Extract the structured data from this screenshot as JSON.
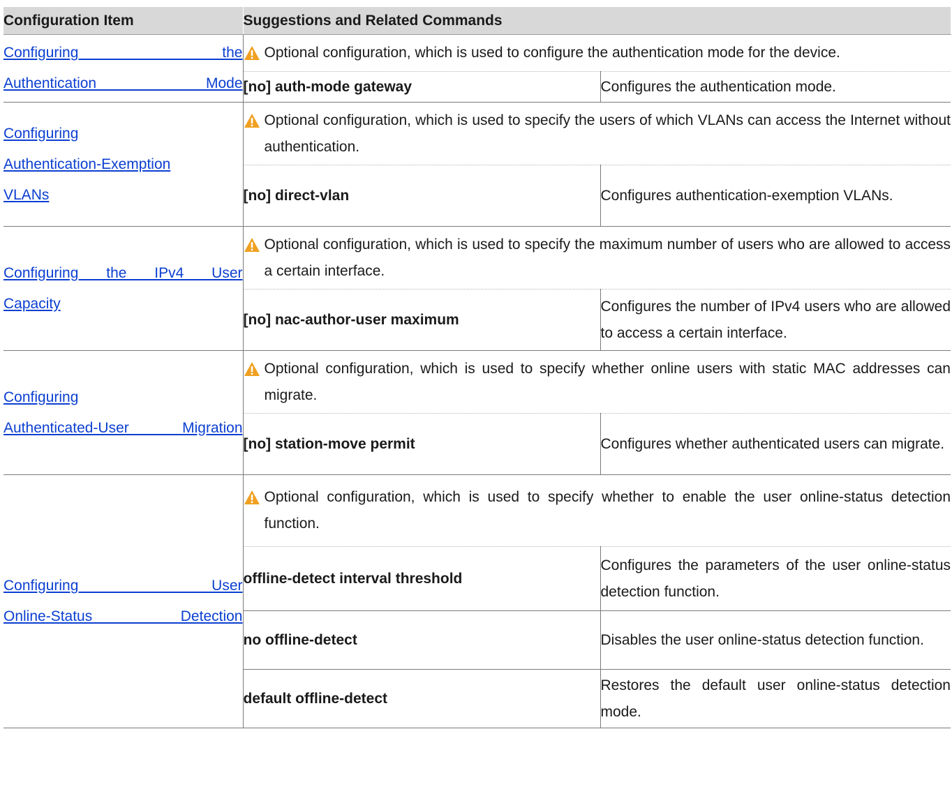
{
  "headers": {
    "config_item": "Configuration Item",
    "suggestions": "Suggestions and Related Commands"
  },
  "rows": [
    {
      "item_lines": [
        "Configuring the",
        "Authentication Mode"
      ],
      "suggestion": "Optional configuration, which is used to configure the authentication mode for the device.",
      "commands": [
        {
          "cmd": "[no] auth-mode gateway",
          "desc": "Configures the authentication mode."
        }
      ]
    },
    {
      "item_lines": [
        "Configuring",
        "Authentication-Exemption",
        "VLANs"
      ],
      "suggestion": "Optional configuration, which is used to specify the users of which VLANs can access the Internet without authentication.",
      "commands": [
        {
          "cmd": "[no] direct-vlan",
          "desc": "Configures authentication-exemption VLANs."
        }
      ]
    },
    {
      "item_lines": [
        "Configuring the IPv4 User",
        "Capacity"
      ],
      "suggestion": "Optional configuration, which is used to specify the maximum number of users who are allowed to access a certain interface.",
      "commands": [
        {
          "cmd": "[no] nac-author-user maximum",
          "desc": "Configures the number of IPv4 users who are allowed to access a certain interface."
        }
      ]
    },
    {
      "item_lines": [
        "Configuring",
        "Authenticated-User Migration"
      ],
      "suggestion": "Optional configuration, which is used to specify whether online users with static MAC addresses can migrate.",
      "commands": [
        {
          "cmd": "[no] station-move permit",
          "desc": "Configures whether authenticated users can migrate."
        }
      ]
    },
    {
      "item_lines": [
        "Configuring User",
        "Online-Status Detection"
      ],
      "suggestion": "Optional configuration, which is used to specify whether to enable the user online-status detection function.",
      "commands": [
        {
          "cmd": "offline-detect interval threshold",
          "desc": "Configures the parameters of the user online-status detection function."
        },
        {
          "cmd": "no offline-detect",
          "desc": "Disables the user online-status detection function."
        },
        {
          "cmd": "default offline-detect",
          "desc": "Restores the default user online-status detection mode."
        }
      ]
    }
  ],
  "colors": {
    "header_bg": "#d8d8d8",
    "link": "#0b3fd1",
    "warning_icon": "#f0a020"
  },
  "icon": "warning-triangle-icon"
}
